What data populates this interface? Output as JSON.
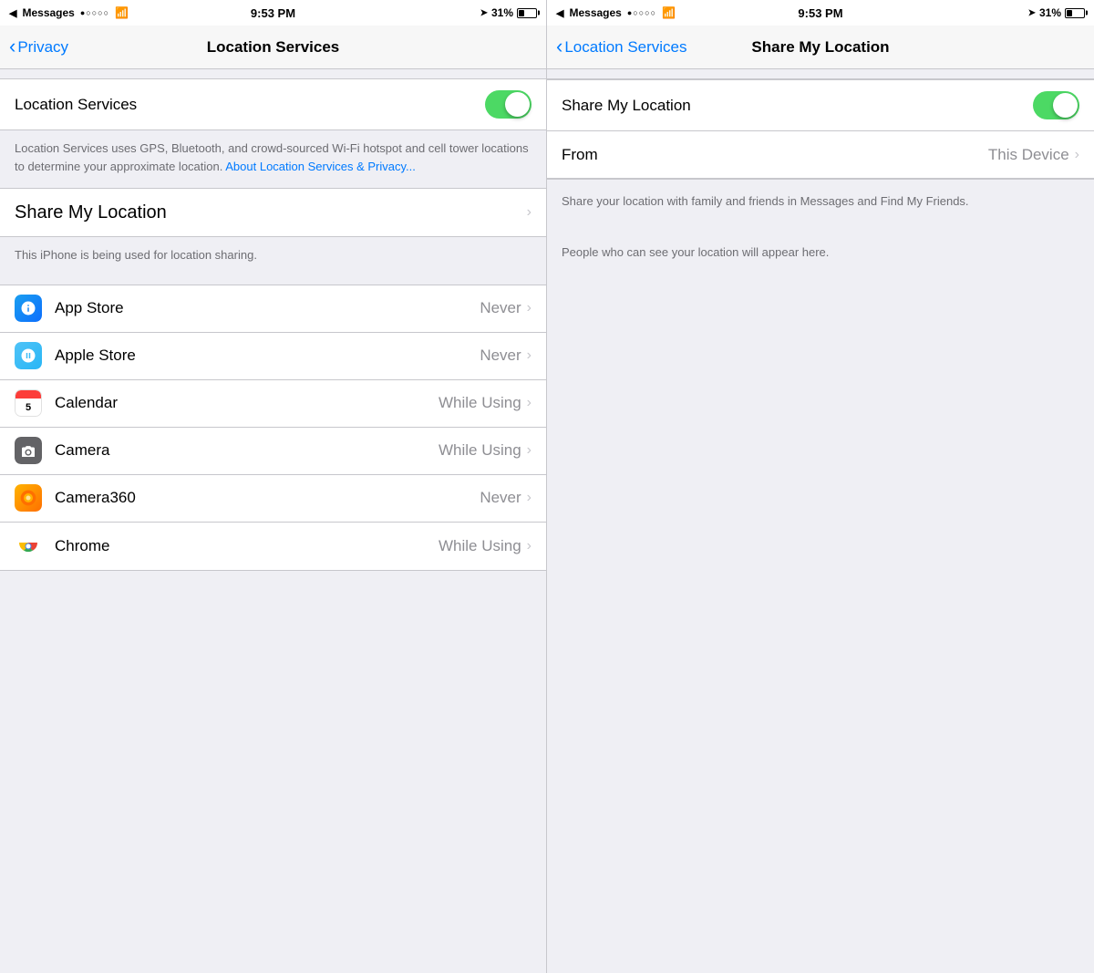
{
  "left_status": {
    "app": "Messages",
    "signal": "●○○○○",
    "wifi": "WiFi",
    "time": "9:53 PM",
    "location": true,
    "battery_pct": "31%"
  },
  "right_status": {
    "app": "Messages",
    "signal": "●○○○○",
    "wifi": "WiFi",
    "time": "9:53 PM",
    "location": true,
    "battery_pct": "31%"
  },
  "left_nav": {
    "back_label": "Privacy",
    "title": "Location Services"
  },
  "right_nav": {
    "back_label": "Location Services",
    "title": "Share My Location"
  },
  "left_panel": {
    "location_services_label": "Location Services",
    "location_services_toggle": true,
    "description": "Location Services uses GPS, Bluetooth, and crowd-sourced Wi-Fi hotspot and cell tower locations to determine your approximate location.",
    "description_link": "About Location Services & Privacy...",
    "share_my_location_label": "Share My Location",
    "share_my_location_note": "This iPhone is being used for location sharing.",
    "apps": [
      {
        "name": "App Store",
        "icon": "appstore",
        "permission": "Never"
      },
      {
        "name": "Apple Store",
        "icon": "applestore",
        "permission": "Never"
      },
      {
        "name": "Calendar",
        "icon": "calendar",
        "permission": "While Using"
      },
      {
        "name": "Camera",
        "icon": "camera",
        "permission": "While Using"
      },
      {
        "name": "Camera360",
        "icon": "camera360",
        "permission": "Never"
      },
      {
        "name": "Chrome",
        "icon": "chrome",
        "permission": "While Using"
      }
    ]
  },
  "right_panel": {
    "share_my_location_label": "Share My Location",
    "share_my_location_toggle": true,
    "from_label": "From",
    "from_value": "This Device",
    "description1": "Share your location with family and friends in Messages and Find My Friends.",
    "people_note": "People who can see your location will appear here."
  }
}
